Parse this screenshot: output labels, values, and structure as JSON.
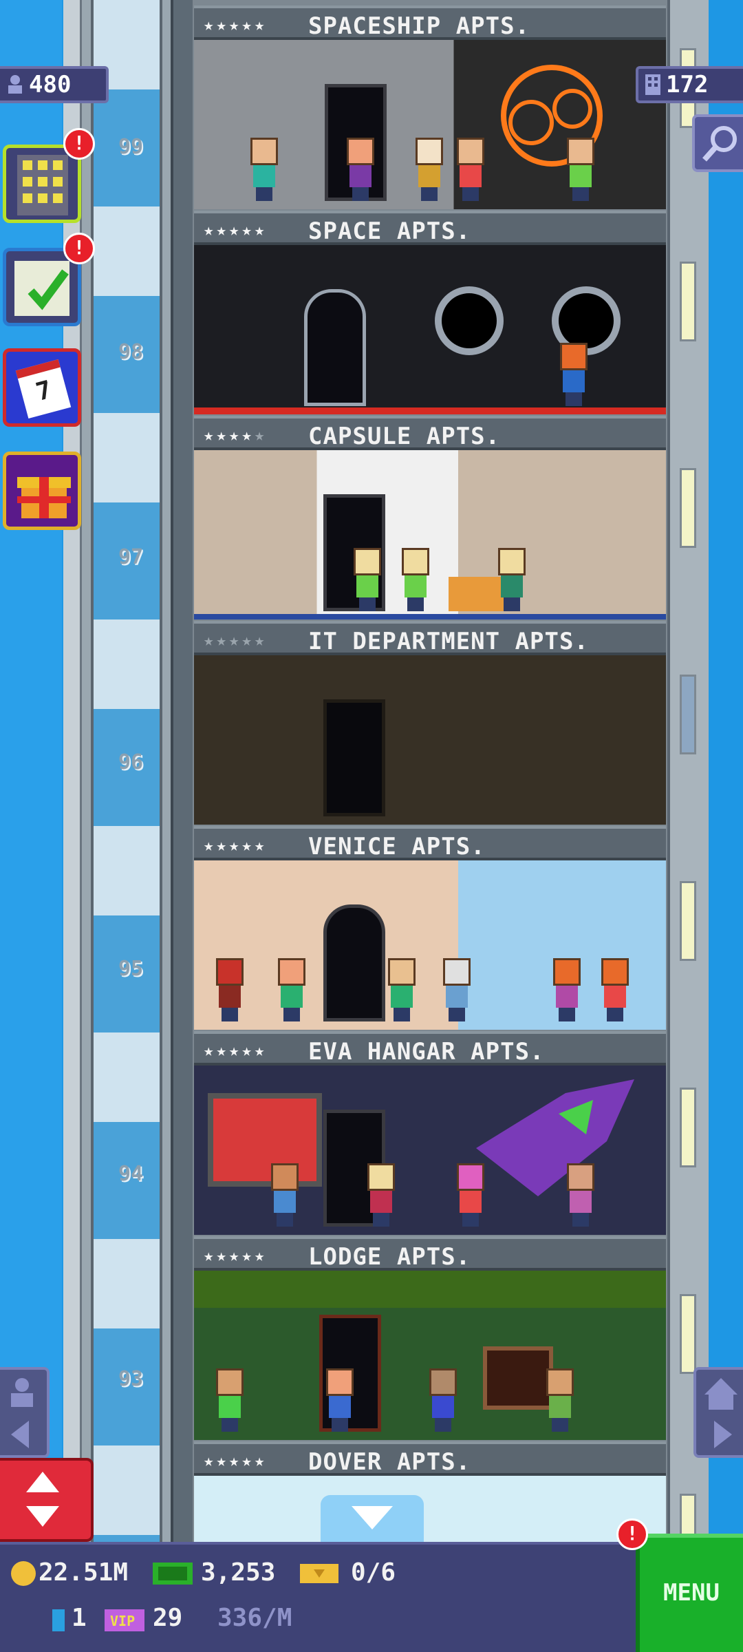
{
  "hud_top": {
    "population": "480",
    "floors_count": "172"
  },
  "floors": [
    {
      "name": "SPACESHIP APTS.",
      "stars_on": 5,
      "floor_number": "99"
    },
    {
      "name": "SPACE APTS.",
      "stars_on": 5,
      "floor_number": "98"
    },
    {
      "name": "CAPSULE APTS.",
      "stars_on": 4,
      "floor_number": "97"
    },
    {
      "name": "IT DEPARTMENT APTS.",
      "stars_on": 0,
      "floor_number": "96"
    },
    {
      "name": "VENICE APTS.",
      "stars_on": 5,
      "floor_number": "95"
    },
    {
      "name": "EVA HANGAR APTS.",
      "stars_on": 5,
      "floor_number": "94"
    },
    {
      "name": "LODGE APTS.",
      "stars_on": 5,
      "floor_number": "93"
    },
    {
      "name": "DOVER APTS.",
      "stars_on": 5,
      "floor_number": ""
    }
  ],
  "side_buttons": {
    "notif_1": "!",
    "notif_2": "!",
    "calendar_day": "7"
  },
  "hud_bottom": {
    "coins": "22.51M",
    "bux": "3,253",
    "tickets": "0/6",
    "elevator_count": "1",
    "vip_count": "29",
    "rate": "336/M",
    "menu_label": "MENU",
    "menu_notif": "!"
  },
  "colors": {
    "sky": "#1e97e4",
    "hud": "#3e4275",
    "menu": "#19b02a",
    "alert": "#e8202a"
  }
}
